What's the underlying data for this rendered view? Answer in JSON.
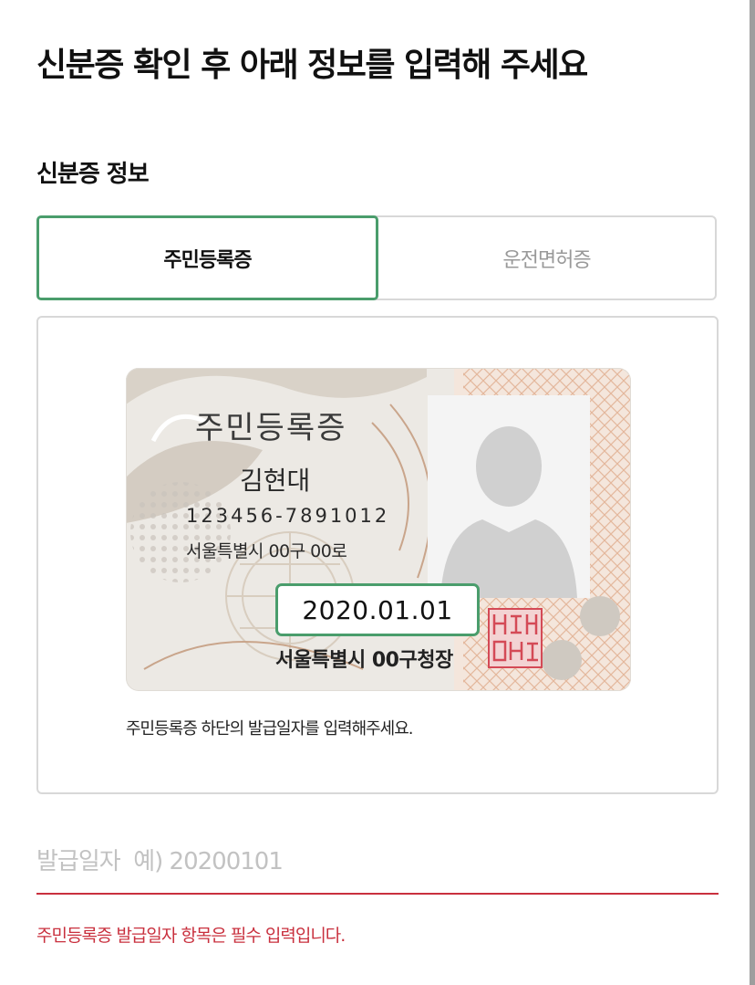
{
  "header": {
    "title": "신분증 확인 후 아래 정보를 입력해 주세요"
  },
  "section": {
    "title": "신분증 정보"
  },
  "tabs": [
    {
      "label": "주민등록증",
      "active": true
    },
    {
      "label": "운전면허증",
      "active": false
    }
  ],
  "id_card": {
    "title": "주민등록증",
    "name": "김현대",
    "number": "123456-7891012",
    "address": "서울특별시 00구 00로",
    "issue_date": "2020.01.01",
    "issuer": "서울특별시 00구청장",
    "seal_icon": "official-seal-icon",
    "photo_icon": "person-silhouette-icon"
  },
  "card_hint": "주민등록증 하단의 발급일자를 입력해주세요.",
  "issue_date_input": {
    "value": "",
    "placeholder": "발급일자  예) 20200101"
  },
  "error": {
    "message": "주민등록증 발급일자 항목은 필수 입력입니다."
  },
  "colors": {
    "accent_green": "#4a9d6c",
    "error_red": "#c9303e",
    "border_gray": "#d8d8d8"
  }
}
